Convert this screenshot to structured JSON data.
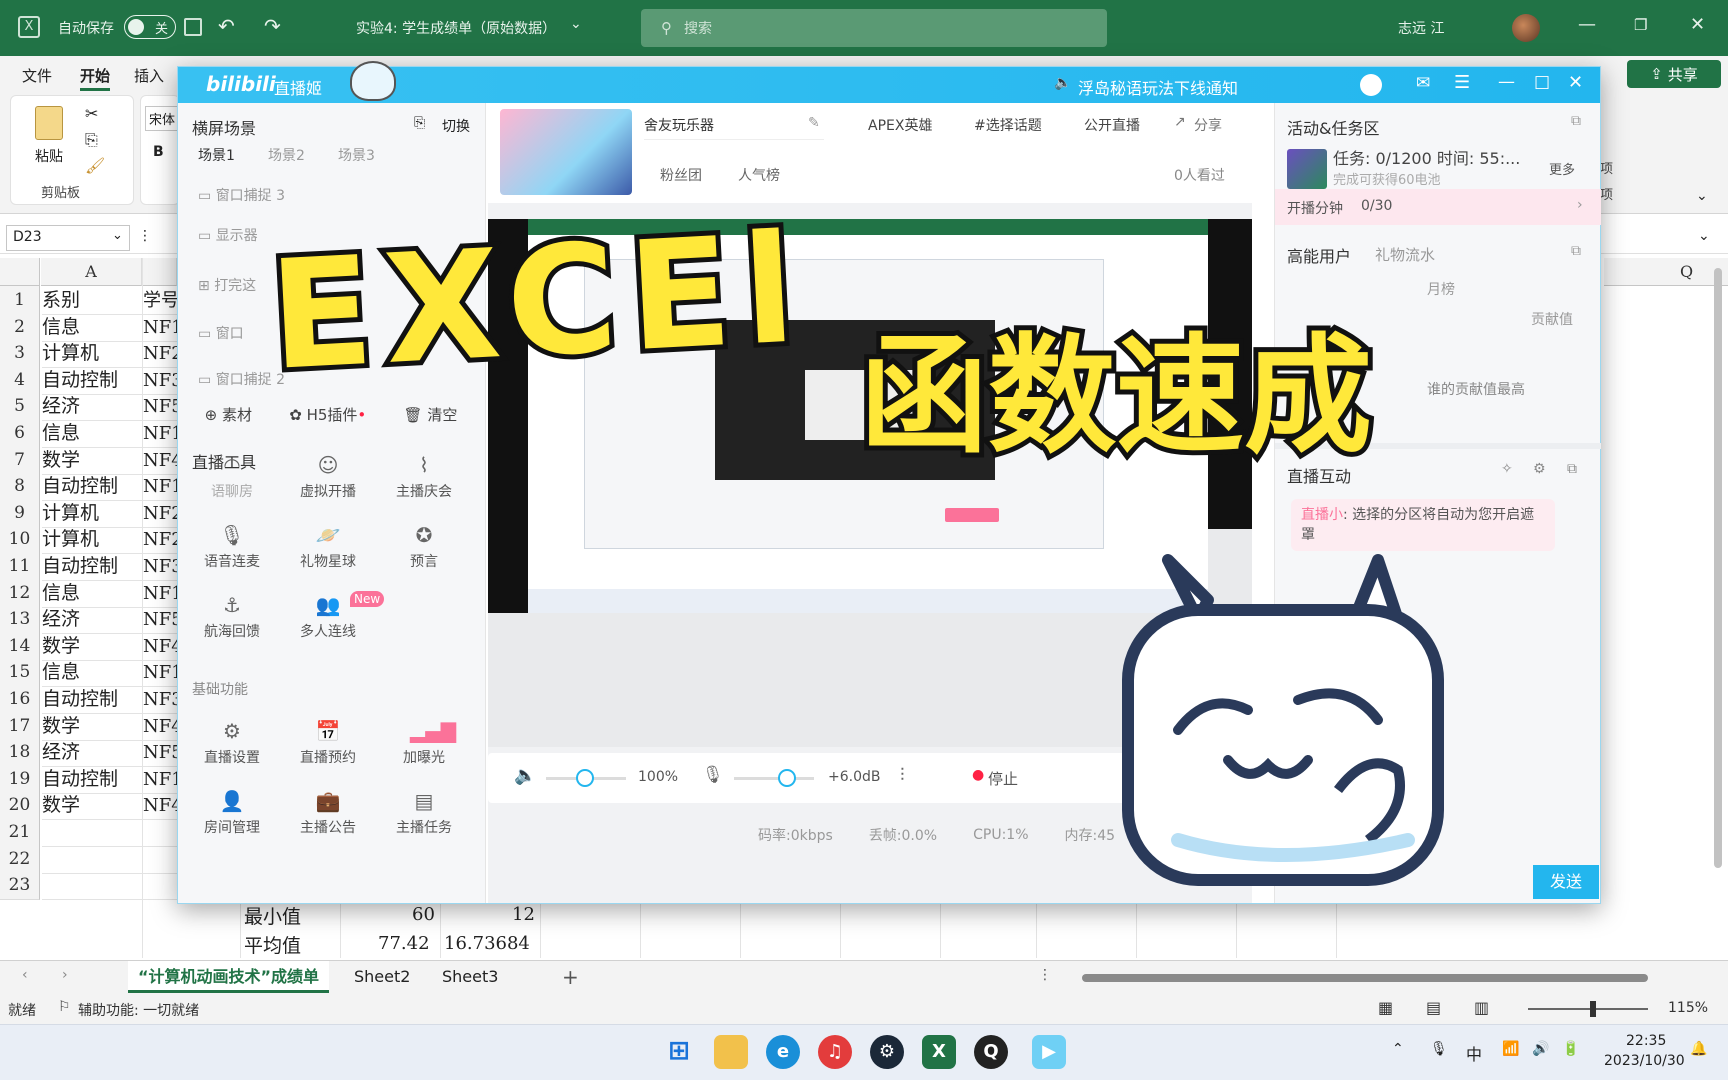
{
  "excel": {
    "autosave_label": "自动保存",
    "autosave_state": "关",
    "doc_title": "实验4: 学生成绩单（原始数据）",
    "search_placeholder": "搜索",
    "user_name": "志远 江",
    "share_label": "共享",
    "menu": [
      "文件",
      "开始",
      "插入"
    ],
    "ribbon": {
      "paste": "粘贴",
      "clipboard": "剪贴板",
      "font": "宋体",
      "bold": "B",
      "right_a": "项",
      "right_b": "项"
    },
    "name_box": "D23",
    "column_a": "A",
    "column_q": "Q",
    "rows": [
      {
        "n": "1",
        "a": "系别",
        "b": "学号"
      },
      {
        "n": "2",
        "a": "信息",
        "b": "NF1"
      },
      {
        "n": "3",
        "a": "计算机",
        "b": "NF2"
      },
      {
        "n": "4",
        "a": "自动控制",
        "b": "NF3"
      },
      {
        "n": "5",
        "a": "经济",
        "b": "NF5"
      },
      {
        "n": "6",
        "a": "信息",
        "b": "NF1"
      },
      {
        "n": "7",
        "a": "数学",
        "b": "NF4"
      },
      {
        "n": "8",
        "a": "自动控制",
        "b": "NF1"
      },
      {
        "n": "9",
        "a": "计算机",
        "b": "NF2"
      },
      {
        "n": "10",
        "a": "计算机",
        "b": "NF2"
      },
      {
        "n": "11",
        "a": "自动控制",
        "b": "NF3"
      },
      {
        "n": "12",
        "a": "信息",
        "b": "NF1"
      },
      {
        "n": "13",
        "a": "经济",
        "b": "NF5"
      },
      {
        "n": "14",
        "a": "数学",
        "b": "NF4"
      },
      {
        "n": "15",
        "a": "信息",
        "b": "NF1"
      },
      {
        "n": "16",
        "a": "自动控制",
        "b": "NF3"
      },
      {
        "n": "17",
        "a": "数学",
        "b": "NF4"
      },
      {
        "n": "18",
        "a": "经济",
        "b": "NF5"
      },
      {
        "n": "19",
        "a": "自动控制",
        "b": "NF1"
      },
      {
        "n": "20",
        "a": "数学",
        "b": "NF4"
      },
      {
        "n": "21",
        "a": "",
        "b": ""
      },
      {
        "n": "22",
        "a": "",
        "b": ""
      },
      {
        "n": "23",
        "a": "",
        "b": ""
      }
    ],
    "stats": [
      {
        "label": "最小值",
        "v1": "60",
        "v2": "12"
      },
      {
        "label": "平均值",
        "v1": "77.42",
        "v2": "16.73684"
      }
    ],
    "sheets": [
      "“计算机动画技术”成绩单",
      "Sheet2",
      "Sheet3"
    ],
    "status_ready": "就绪",
    "status_accessibility": "辅助功能: 一切就绪",
    "zoom": "115%"
  },
  "taskbar": {
    "time": "22:35",
    "date": "2023/10/30",
    "ime": "中"
  },
  "bili": {
    "app_name": "直播姬",
    "notice": "浮岛秘语玩法下线通知",
    "scene_title": "横屏场景",
    "switch_label": "切换",
    "scene_tabs": [
      "场景1",
      "场景2",
      "场景3"
    ],
    "sources": [
      "窗口捕捉 3",
      "显示器",
      "打完这",
      "窗口",
      "窗口捕捉 2"
    ],
    "source_actions": [
      "素材",
      "H5插件",
      "清空"
    ],
    "tools_title": "直播工具",
    "tools": [
      "语聊房",
      "虚拟开播",
      "主播庆会",
      "语音连麦",
      "礼物星球",
      "预言",
      "航海回馈",
      "多人连线"
    ],
    "new_badge": "New",
    "basic_title": "基础功能",
    "basic": [
      "直播设置",
      "直播预约",
      "加曝光",
      "房间管理",
      "主播公告",
      "主播任务"
    ],
    "room_name": "舍友玩乐器",
    "category": "APEX英雄",
    "topic": "#选择话题",
    "public": "公开直播",
    "share": "分享",
    "fans": "粉丝团",
    "rank": "人气榜",
    "viewers": "0人看过",
    "volume": "100%",
    "mic_gain": "+6.0dB",
    "stop": "停止",
    "stats": [
      "码率:0kbps",
      "丢帧:0.0%",
      "CPU:1%",
      "内存:45"
    ],
    "activity_title": "活动&任务区",
    "task_text": "任务: 0/1200 时间: 55:...",
    "task_sub": "完成可获得60电池",
    "more": "更多",
    "open_minutes": "开播分钟",
    "open_minutes_val": "0/30",
    "hi_users": "高能用户",
    "gift_flow": "礼物流水",
    "month_rank": "月榜",
    "contribution": "贡献值",
    "contrib_note": "谁的贡献值最高",
    "interact_title": "直播互动",
    "interact_tag": "直播小",
    "interact_msg": "选择的分区将自动为您开启遮罩",
    "send": "发送"
  },
  "overlay": {
    "line1": "EXCEl",
    "line2": "函数速成"
  },
  "colors": {
    "excel_green": "#217346",
    "bili_blue": "#23b6ee",
    "overlay_yellow": "#ffe83a",
    "accent_pink": "#fb7299"
  }
}
